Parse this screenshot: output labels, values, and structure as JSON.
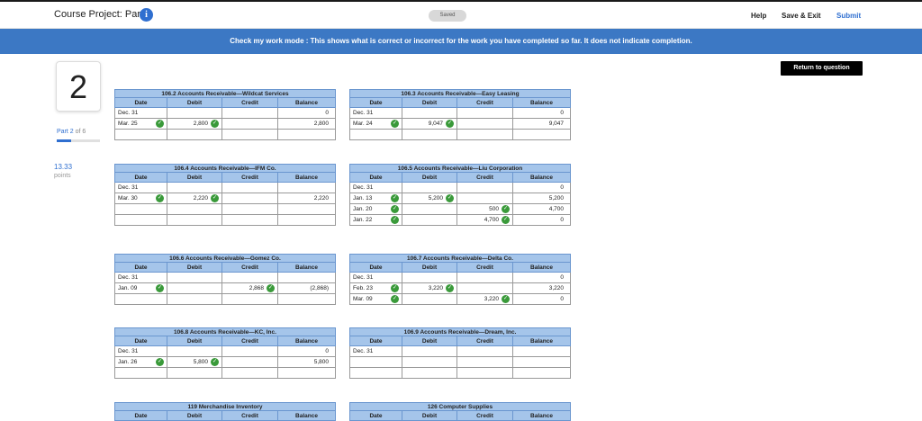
{
  "header": {
    "course_title": "Course Project: Part 2",
    "saved": "Saved",
    "help": "Help",
    "save_exit": "Save & Exit",
    "submit": "Submit"
  },
  "banner": "Check my work mode : This shows what is correct or incorrect for the work you have completed so far. It does not indicate completion.",
  "return_button": "Return to question",
  "question": {
    "number": "2",
    "part_prefix": "Part 2",
    "part_suffix": " of 6",
    "progress_fraction": 0.33,
    "points": "13.33",
    "points_label": "points"
  },
  "ledgers": [
    {
      "title": "106.2 Accounts Receivable—Wildcat Services",
      "headers": [
        "Date",
        "Debit",
        "Credit",
        "Balance"
      ],
      "rows": [
        {
          "date": "Dec. 31",
          "debit": "",
          "credit": "",
          "balance": "0"
        },
        {
          "date": "Mar. 25",
          "debit": "2,800",
          "credit": "",
          "balance": "2,800"
        },
        {
          "date": "",
          "debit": "",
          "credit": "",
          "balance": ""
        }
      ]
    },
    {
      "title": "106.3 Accounts Receivable—Easy Leasing",
      "headers": [
        "Date",
        "Debit",
        "Credit",
        "Balance"
      ],
      "rows": [
        {
          "date": "Dec. 31",
          "debit": "",
          "credit": "",
          "balance": "0"
        },
        {
          "date": "Mar. 24",
          "debit": "9,047",
          "credit": "",
          "balance": "9,047"
        },
        {
          "date": "",
          "debit": "",
          "credit": "",
          "balance": ""
        }
      ]
    },
    {
      "title": "106.4 Accounts Receivable—IFM Co.",
      "headers": [
        "Date",
        "Debit",
        "Credit",
        "Balance"
      ],
      "rows": [
        {
          "date": "Dec. 31",
          "debit": "",
          "credit": "",
          "balance": ""
        },
        {
          "date": "Mar. 30",
          "debit": "2,220",
          "credit": "",
          "balance": "2,220"
        },
        {
          "date": "",
          "debit": "",
          "credit": "",
          "balance": ""
        },
        {
          "date": "",
          "debit": "",
          "credit": "",
          "balance": ""
        }
      ]
    },
    {
      "title": "106.5 Accounts Receivable—Liu Corporation",
      "headers": [
        "Date",
        "Debit",
        "Credit",
        "Balance"
      ],
      "rows": [
        {
          "date": "Dec. 31",
          "debit": "",
          "credit": "",
          "balance": "0"
        },
        {
          "date": "Jan. 13",
          "debit": "5,200",
          "credit": "",
          "balance": "5,200"
        },
        {
          "date": "Jan. 20",
          "debit": "",
          "credit": "500",
          "balance": "4,700"
        },
        {
          "date": "Jan. 22",
          "debit": "",
          "credit": "4,700",
          "balance": "0"
        }
      ]
    },
    {
      "title": "106.6 Accounts Receivable—Gomez Co.",
      "headers": [
        "Date",
        "Debit",
        "Credit",
        "Balance"
      ],
      "rows": [
        {
          "date": "Dec. 31",
          "debit": "",
          "credit": "",
          "balance": ""
        },
        {
          "date": "Jan. 09",
          "debit": "",
          "credit": "2,868",
          "balance": "(2,868)"
        },
        {
          "date": "",
          "debit": "",
          "credit": "",
          "balance": ""
        }
      ]
    },
    {
      "title": "106.7 Accounts Receivable—Delta Co.",
      "headers": [
        "Date",
        "Debit",
        "Credit",
        "Balance"
      ],
      "rows": [
        {
          "date": "Dec. 31",
          "debit": "",
          "credit": "",
          "balance": "0"
        },
        {
          "date": "Feb. 23",
          "debit": "3,220",
          "credit": "",
          "balance": "3,220"
        },
        {
          "date": "Mar. 09",
          "debit": "",
          "credit": "3,220",
          "balance": "0"
        }
      ]
    },
    {
      "title": "106.8 Accounts Receivable—KC, Inc.",
      "headers": [
        "Date",
        "Debit",
        "Credit",
        "Balance"
      ],
      "rows": [
        {
          "date": "Dec. 31",
          "debit": "",
          "credit": "",
          "balance": "0"
        },
        {
          "date": "Jan. 26",
          "debit": "5,800",
          "credit": "",
          "balance": "5,800"
        },
        {
          "date": "",
          "debit": "",
          "credit": "",
          "balance": ""
        }
      ]
    },
    {
      "title": "106.9 Accounts Receivable—Dream, Inc.",
      "headers": [
        "Date",
        "Debit",
        "Credit",
        "Balance"
      ],
      "rows": [
        {
          "date": "Dec. 31",
          "debit": "",
          "credit": "",
          "balance": ""
        },
        {
          "date": "",
          "debit": "",
          "credit": "",
          "balance": ""
        },
        {
          "date": "",
          "debit": "",
          "credit": "",
          "balance": ""
        }
      ]
    },
    {
      "title": "119 Merchandise Inventory",
      "headers": [
        "Date",
        "Debit",
        "Credit",
        "Balance"
      ],
      "rows": []
    },
    {
      "title": "126 Computer Supplies",
      "headers": [
        "Date",
        "Debit",
        "Credit",
        "Balance"
      ],
      "rows": []
    }
  ],
  "colors": {
    "banner": "#3c78c4",
    "table_header": "#a5c5ea",
    "check": "#3a9a3a",
    "link": "#2f6fd0"
  }
}
